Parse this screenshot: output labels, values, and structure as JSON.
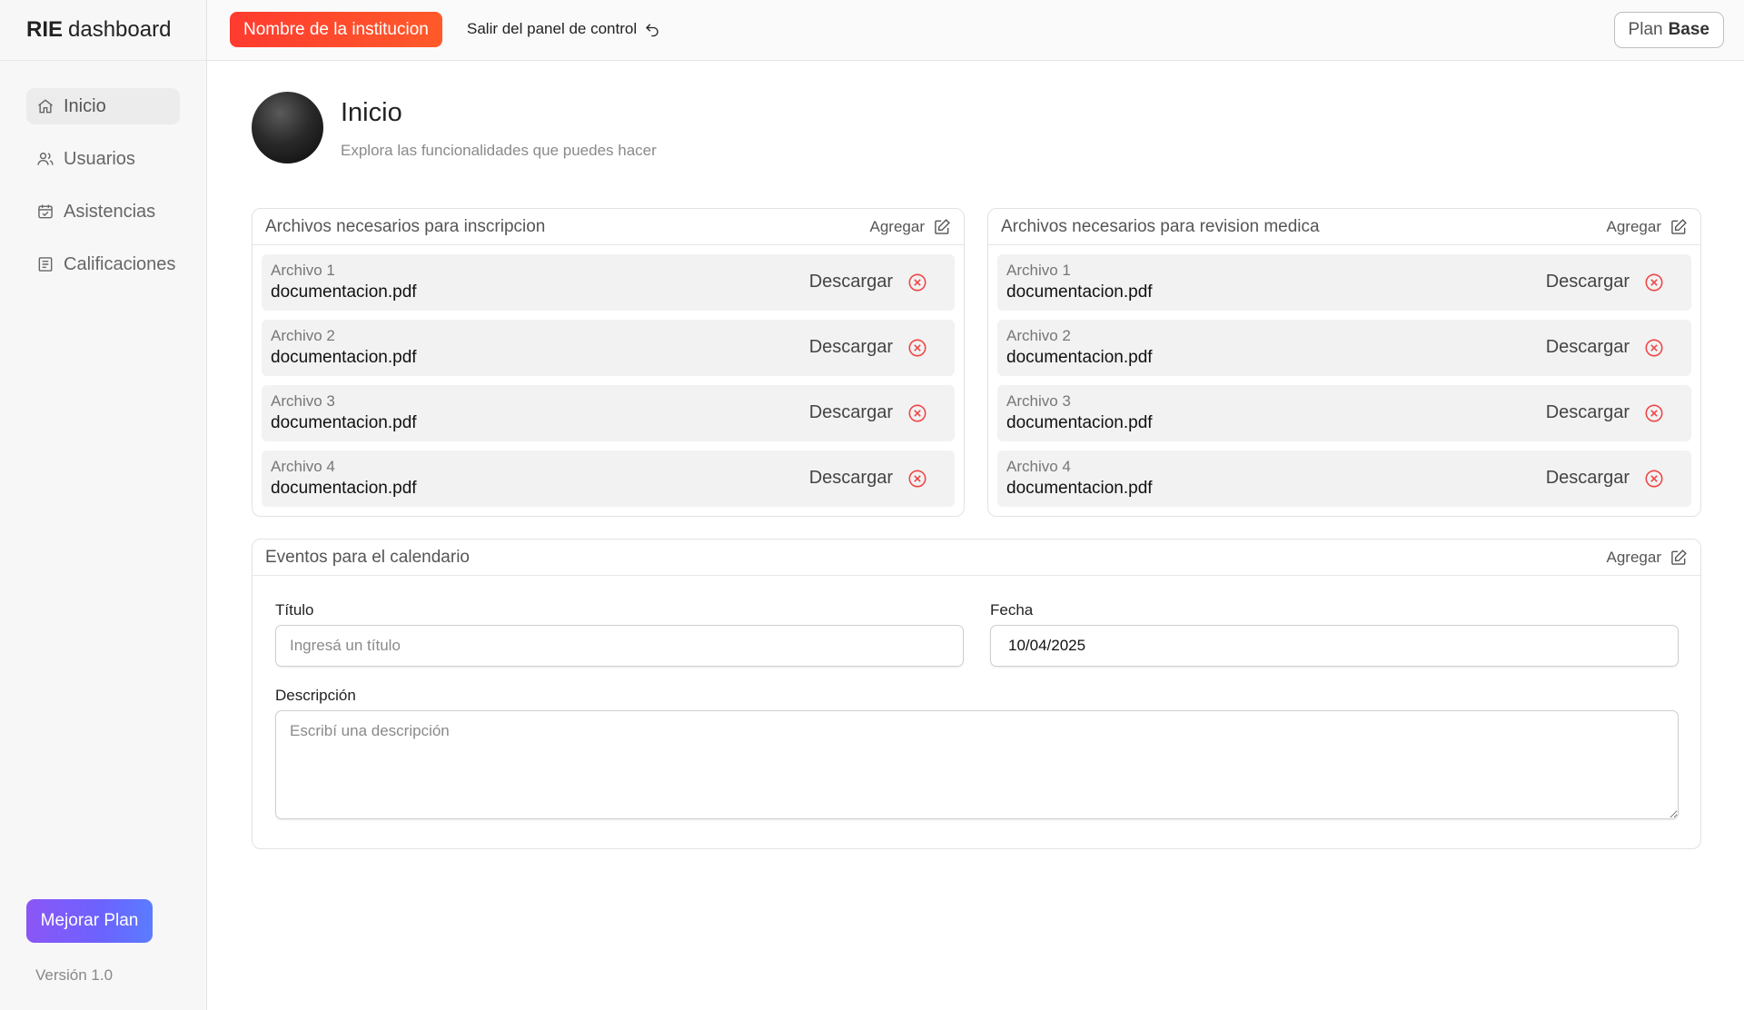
{
  "brand": {
    "bold": "RIE",
    "rest": "dashboard"
  },
  "sidebar": {
    "items": [
      {
        "label": "Inicio",
        "icon": "home-icon",
        "active": true
      },
      {
        "label": "Usuarios",
        "icon": "users-icon",
        "active": false
      },
      {
        "label": "Asistencias",
        "icon": "calendar-check-icon",
        "active": false
      },
      {
        "label": "Calificaciones",
        "icon": "document-list-icon",
        "active": false
      }
    ],
    "upgrade_label": "Mejorar Plan",
    "version": "Versión 1.0"
  },
  "topbar": {
    "institution_label": "Nombre de la institucion",
    "exit_label": "Salir del panel de control",
    "plan_prefix": "Plan",
    "plan_name": "Base"
  },
  "header": {
    "title": "Inicio",
    "subtitle": "Explora las funcionalidades que puedes hacer"
  },
  "cards": {
    "inscripcion": {
      "title": "Archivos necesarios para inscripcion",
      "add_label": "Agregar",
      "files": [
        {
          "label": "Archivo 1",
          "name": "documentacion.pdf",
          "download": "Descargar"
        },
        {
          "label": "Archivo 2",
          "name": "documentacion.pdf",
          "download": "Descargar"
        },
        {
          "label": "Archivo 3",
          "name": "documentacion.pdf",
          "download": "Descargar"
        },
        {
          "label": "Archivo 4",
          "name": "documentacion.pdf",
          "download": "Descargar"
        }
      ]
    },
    "medica": {
      "title": "Archivos necesarios para revision medica",
      "add_label": "Agregar",
      "files": [
        {
          "label": "Archivo 1",
          "name": "documentacion.pdf",
          "download": "Descargar"
        },
        {
          "label": "Archivo 2",
          "name": "documentacion.pdf",
          "download": "Descargar"
        },
        {
          "label": "Archivo 3",
          "name": "documentacion.pdf",
          "download": "Descargar"
        },
        {
          "label": "Archivo 4",
          "name": "documentacion.pdf",
          "download": "Descargar"
        }
      ]
    },
    "eventos": {
      "title": "Eventos para el calendario",
      "add_label": "Agregar",
      "titulo_label": "Título",
      "titulo_placeholder": "Ingresá un título",
      "fecha_label": "Fecha",
      "fecha_value": "10/04/2025",
      "descripcion_label": "Descripción",
      "descripcion_placeholder": "Escribí una descripción"
    }
  },
  "colors": {
    "institution_button": "#ff3b2f",
    "upgrade_gradient_start": "#8b56f5",
    "upgrade_gradient_end": "#5b7cff",
    "delete_icon": "#ef4444"
  }
}
